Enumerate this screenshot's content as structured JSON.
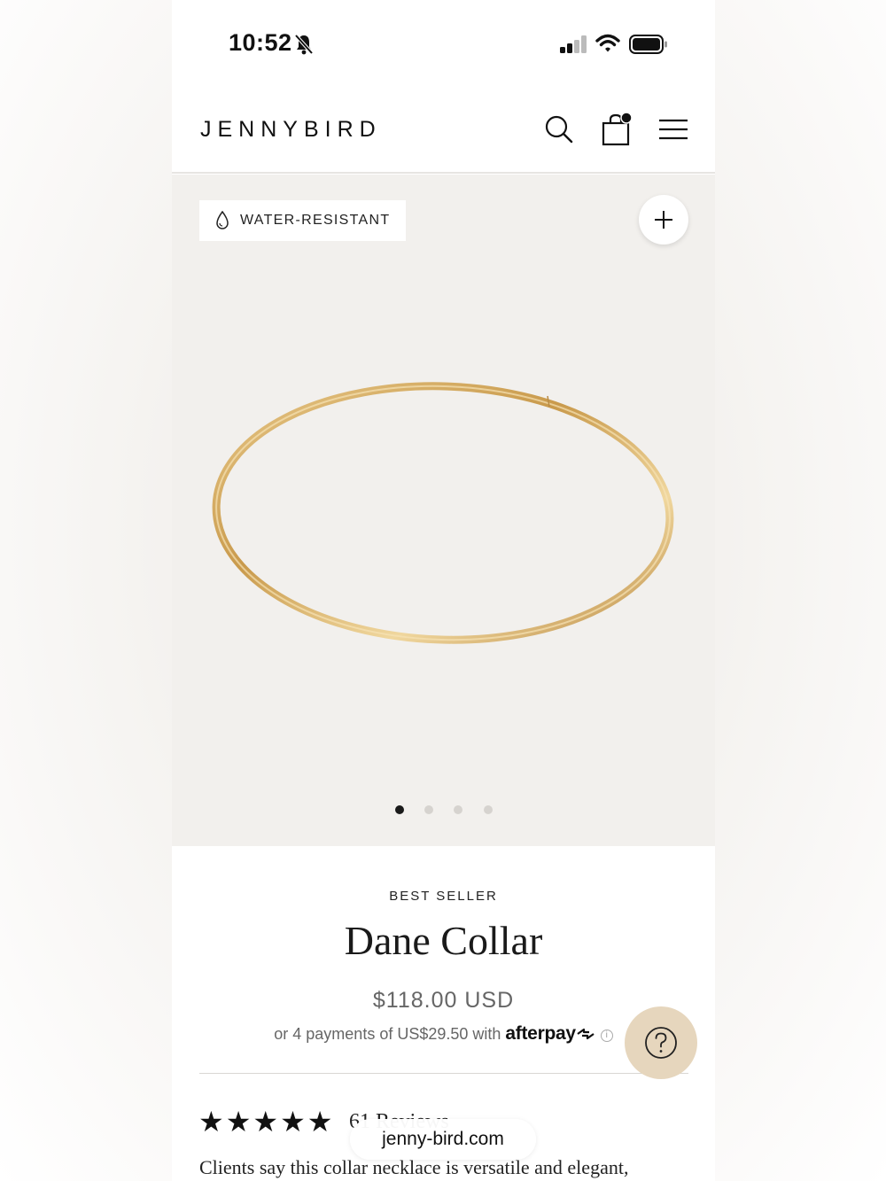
{
  "status_bar": {
    "time": "10:52",
    "icons": [
      "bell-slash-icon",
      "cellular-signal-icon",
      "wifi-icon",
      "battery-icon"
    ]
  },
  "header": {
    "logo": "JENNYBIRD",
    "icons": [
      "search-icon",
      "shopping-bag-icon",
      "hamburger-menu-icon"
    ]
  },
  "hero": {
    "badge_label": "WATER-RESISTANT",
    "badge_icon": "water-drop-icon",
    "zoom_icon": "plus-icon",
    "carousel": {
      "total_slides": 4,
      "active_slide": 1
    },
    "image_alt": "gold-collar-necklace-image"
  },
  "product": {
    "eyebrow": "BEST SELLER",
    "title": "Dane Collar",
    "price": "$118.00 USD",
    "installment_text": "or 4 payments of US$29.50 with",
    "afterpay_brand": "afterpay",
    "rating_stars": "★★★★★",
    "rating_value": 5,
    "reviews_label": "61 Reviews",
    "description": "Clients say this collar necklace is versatile and elegant,"
  },
  "floating": {
    "help_icon": "question-mark-icon",
    "url": "jenny-bird.com"
  },
  "colors": {
    "hero_bg": "#f2f0ed",
    "help_button_bg": "#e6d6bd",
    "gold": "#d9b36a",
    "text": "#1a1a1a",
    "muted": "#666666"
  }
}
